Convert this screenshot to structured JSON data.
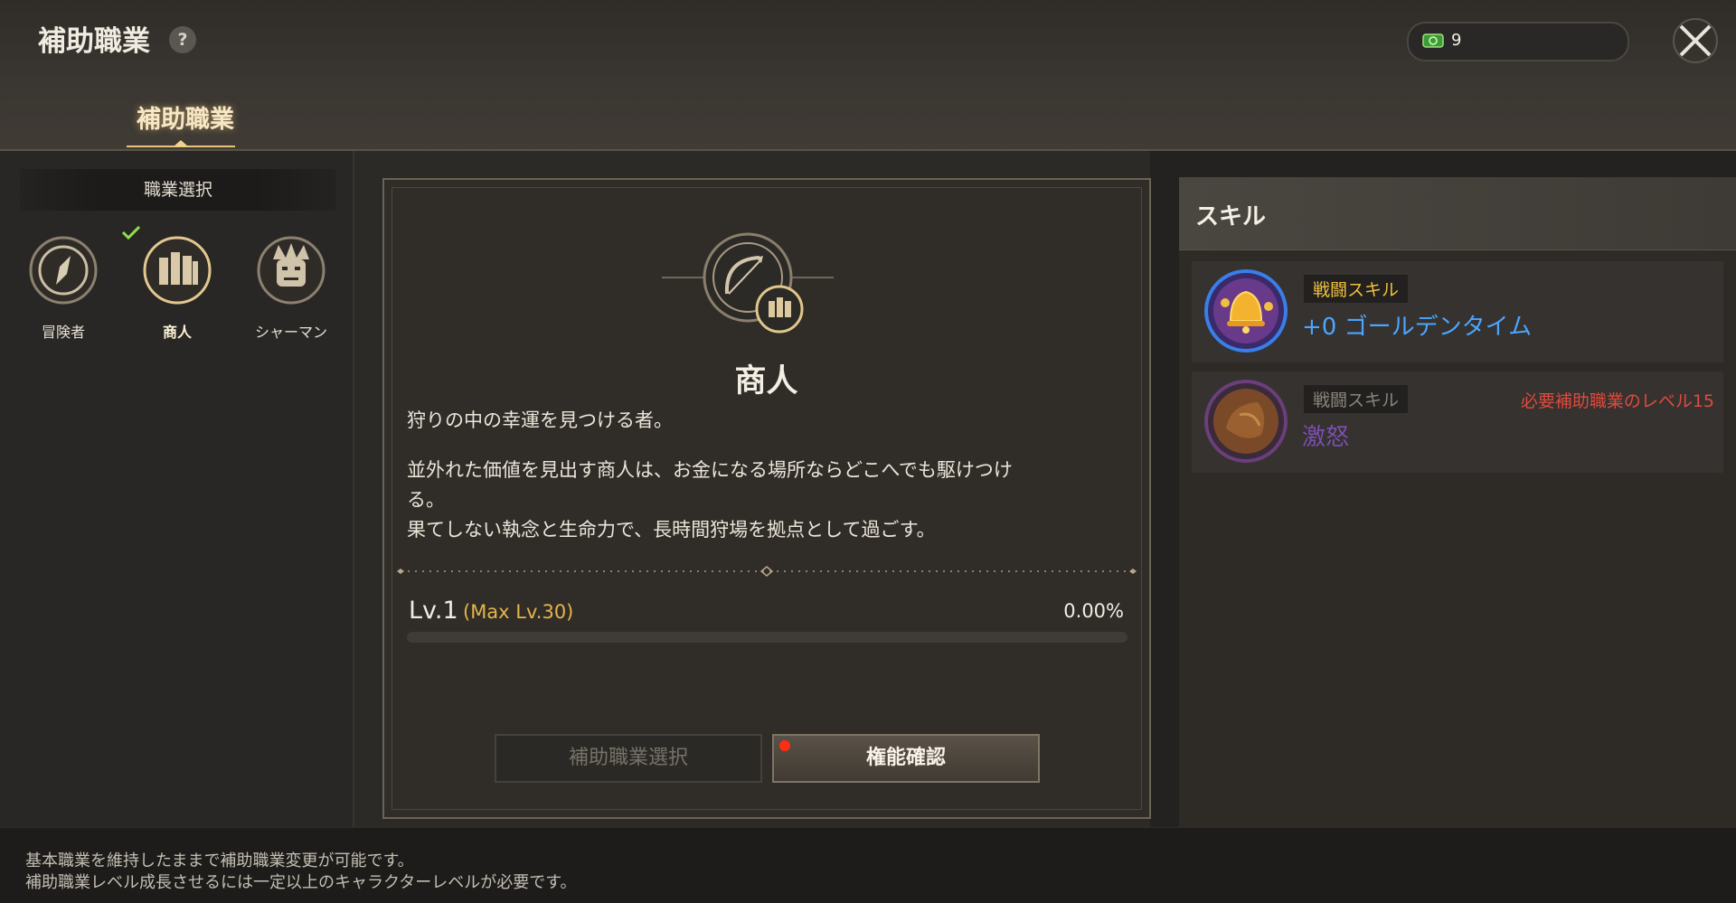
{
  "header": {
    "title": "補助職業",
    "help_symbol": "?",
    "currency_value": "9",
    "currency_icon": "ticket-icon",
    "tab_label": "補助職業"
  },
  "job_select": {
    "header": "職業選択",
    "jobs": [
      {
        "label": "冒険者",
        "icon": "compass-icon"
      },
      {
        "label": "商人",
        "icon": "coins-icon",
        "selected": true
      },
      {
        "label": "シャーマン",
        "icon": "mask-icon"
      }
    ]
  },
  "detail": {
    "name": "商人",
    "tagline": "狩りの中の幸運を見つける者。",
    "desc_line1": "並外れた価値を見出す商人は、お金になる場所ならどこへでも駆けつけ",
    "desc_line2": "る。",
    "desc_line3": "果てしない執念と生命力で、長時間狩場を拠点として過ごす。",
    "level": "Lv.1",
    "max_level": "(Max Lv.30)",
    "progress_text": "0.00%",
    "progress": 0,
    "btn_select": "補助職業選択",
    "btn_confirm": "権能確認"
  },
  "skills": {
    "header": "スキル",
    "items": [
      {
        "tag": "戦闘スキル",
        "name": "+0 ゴールデンタイム",
        "name_color": "#4aa6ff",
        "tag_color": "#f0c040",
        "icon": "golden-bell-icon"
      },
      {
        "tag": "戦闘スキル",
        "name": "激怒",
        "name_color": "#7a4fae",
        "tag_color": "#8a857c",
        "icon": "rage-icon",
        "requirement": "必要補助職業のレベル15"
      }
    ]
  },
  "footer": {
    "line1": "基本職業を維持したままで補助職業変更が可能です。",
    "line2": "補助職業レベル成長させるには一定以上のキャラクターレベルが必要です。"
  }
}
